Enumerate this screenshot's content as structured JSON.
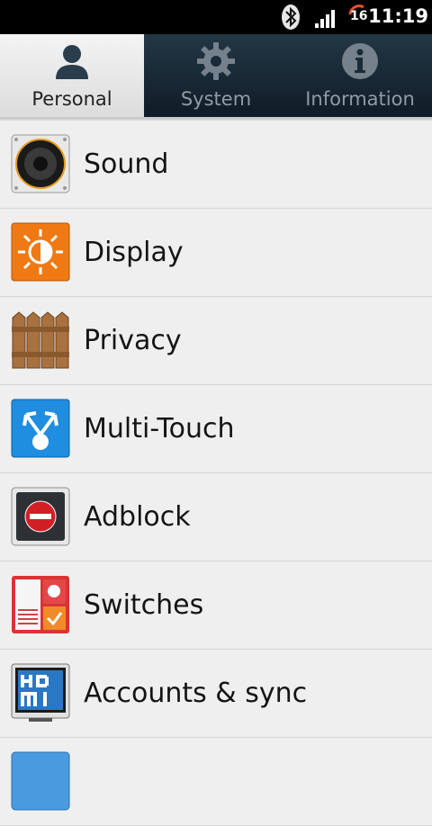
{
  "status_bar": {
    "time": "11:19",
    "notification_count": "16",
    "icons": [
      "bluetooth-icon",
      "signal-icon",
      "battery-icon"
    ]
  },
  "tabs": [
    {
      "label": "Personal",
      "icon": "person-icon",
      "active": true
    },
    {
      "label": "System",
      "icon": "gear-icon",
      "active": false
    },
    {
      "label": "Information",
      "icon": "info-icon",
      "active": false
    }
  ],
  "items": [
    {
      "label": "Sound",
      "icon": "speaker-icon"
    },
    {
      "label": "Display",
      "icon": "sun-icon"
    },
    {
      "label": "Privacy",
      "icon": "fence-icon"
    },
    {
      "label": "Multi-Touch",
      "icon": "multitouch-icon"
    },
    {
      "label": "Adblock",
      "icon": "block-icon"
    },
    {
      "label": "Switches",
      "icon": "switches-icon"
    },
    {
      "label": "Accounts & sync",
      "icon": "hdmi-icon"
    },
    {
      "label": "",
      "icon": "partial-icon"
    }
  ],
  "colors": {
    "tab_bar": "#1b2c38",
    "display_orange": "#ef7a14",
    "multitouch_blue": "#1f8de0",
    "adblock_red": "#d21f26"
  }
}
